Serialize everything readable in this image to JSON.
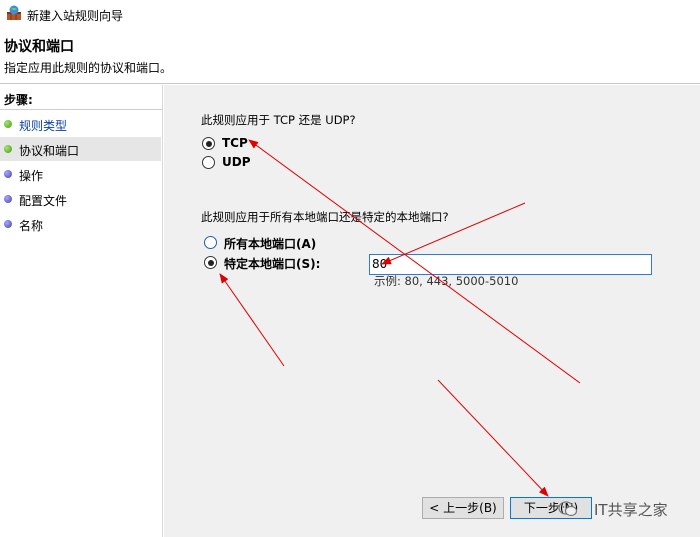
{
  "window": {
    "title": "新建入站规则向导",
    "page_title": "协议和端口",
    "page_desc": "指定应用此规则的协议和端口。"
  },
  "sidebar": {
    "title": "步骤:",
    "items": [
      {
        "label": "规则类型",
        "dot": "green",
        "link": true
      },
      {
        "label": "协议和端口",
        "dot": "green",
        "link": false,
        "active": true
      },
      {
        "label": "操作",
        "dot": "blue",
        "link": false
      },
      {
        "label": "配置文件",
        "dot": "blue",
        "link": false
      },
      {
        "label": "名称",
        "dot": "blue",
        "link": false
      }
    ]
  },
  "content": {
    "protocol_question": "此规则应用于 TCP 还是 UDP?",
    "protocol_options": [
      {
        "label": "TCP",
        "checked": true
      },
      {
        "label": "UDP",
        "checked": false
      }
    ],
    "port_question": "此规则应用于所有本地端口还是特定的本地端口?",
    "port_options": [
      {
        "label": "所有本地端口(A)",
        "checked": false
      },
      {
        "label": "特定本地端口(S):",
        "checked": true
      }
    ],
    "port_value": "80",
    "port_example": "示例: 80, 443, 5000-5010"
  },
  "buttons": {
    "back": "< 上一步(B)",
    "next": "下一步(N)"
  },
  "watermark": {
    "text": "IT共享之家"
  },
  "colors": {
    "accent": "#0078d7",
    "arrow": "#e00000"
  }
}
